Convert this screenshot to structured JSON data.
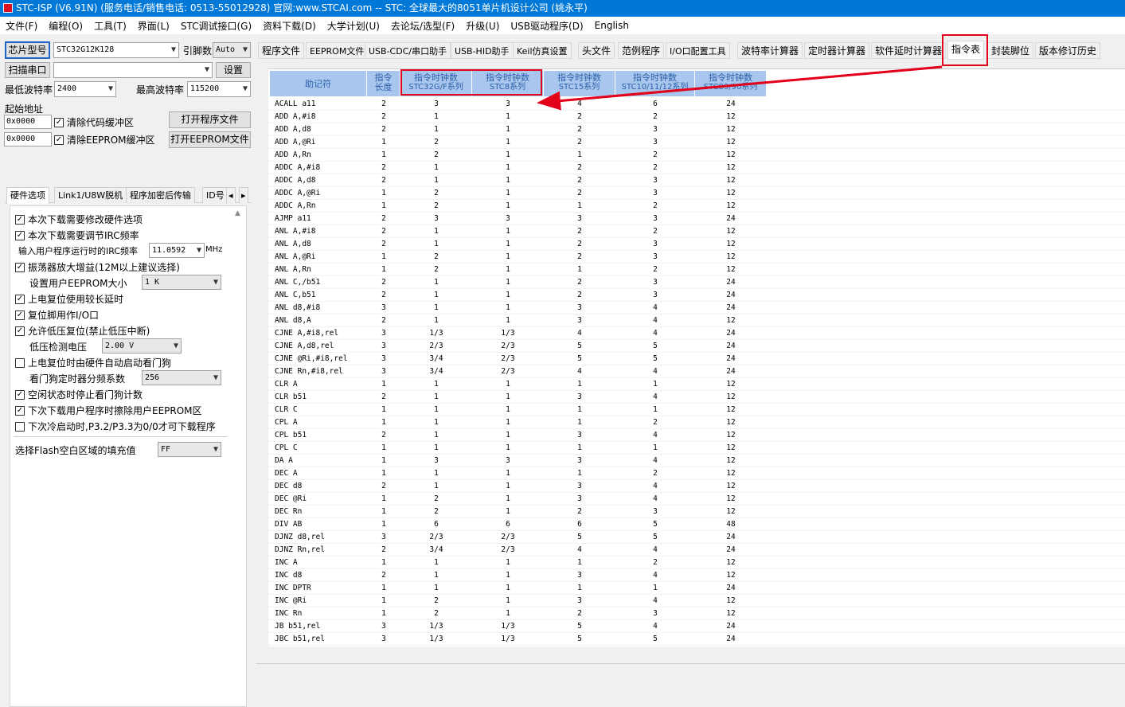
{
  "title": "STC-ISP (V6.91N) (服务电话/销售电话: 0513-55012928) 官网:www.STCAI.com  -- STC: 全球最大的8051单片机设计公司 (姚永平)",
  "menu": [
    "文件(F)",
    "编程(O)",
    "工具(T)",
    "界面(L)",
    "STC调试接口(G)",
    "资料下载(D)",
    "大学计划(U)",
    "去论坛/选型(F)",
    "升级(U)",
    "USB驱动程序(D)",
    "English"
  ],
  "left": {
    "chip_btn": "芯片型号",
    "chip_value": "STC32G12K128",
    "pin_label": "引脚数",
    "pin_value": "Auto",
    "scan_btn": "扫描串口",
    "port_value": "",
    "settings_btn": "设置",
    "min_baud_label": "最低波特率",
    "min_baud": "2400",
    "max_baud_label": "最高波特率",
    "max_baud": "115200",
    "start_addr_label": "起始地址",
    "addr1": "0x0000",
    "addr2": "0x0000",
    "clear_code": "清除代码缓冲区",
    "clear_eeprom": "清除EEPROM缓冲区",
    "open_prog": "打开程序文件",
    "open_eeprom": "打开EEPROM文件",
    "tabs": [
      "硬件选项",
      "Link1/U8W脱机",
      "程序加密后传输",
      "ID号"
    ],
    "opts": {
      "o1": "本次下载需要修改硬件选项",
      "o2": "本次下载需要调节IRC频率",
      "irc_label": "输入用户程序运行时的IRC频率",
      "irc_value": "11.0592",
      "irc_unit": "MHz",
      "o3": "振荡器放大增益(12M以上建议选择)",
      "eeprom_label": "设置用户EEPROM大小",
      "eeprom_value": "1   K",
      "o4": "上电复位使用较长延时",
      "o5": "复位脚用作I/O口",
      "o6": "允许低压复位(禁止低压中断)",
      "lv_label": "低压检测电压",
      "lv_value": "2.00 V",
      "o7": "上电复位时由硬件自动启动看门狗",
      "wdt_label": "看门狗定时器分频系数",
      "wdt_value": "256",
      "o8": "空闲状态时停止看门狗计数",
      "o9": "下次下载用户程序时擦除用户EEPROM区",
      "o10": "下次冷启动时,P3.2/P3.3为0/0才可下载程序",
      "flash_label": "选择Flash空白区域的填充值",
      "flash_value": "FF"
    }
  },
  "right_tabs": [
    "程序文件",
    "EEPROM文件",
    "USB-CDC/串口助手",
    "USB-HID助手",
    "Keil仿真设置",
    "头文件",
    "范例程序",
    "I/O口配置工具",
    "波特率计算器",
    "定时器计算器",
    "软件延时计算器",
    "指令表",
    "封装脚位",
    "版本修订历史"
  ],
  "table": {
    "headers": [
      {
        "l1": "助记符",
        "l2": ""
      },
      {
        "l1": "指令",
        "l2": "长度"
      },
      {
        "l1": "指令时钟数",
        "l2": "STC32G/F系列"
      },
      {
        "l1": "指令时钟数",
        "l2": "STC8系列"
      },
      {
        "l1": "指令时钟数",
        "l2": "STC15系列"
      },
      {
        "l1": "指令时钟数",
        "l2": "STC10/11/12系列"
      },
      {
        "l1": "指令时钟数",
        "l2": "STC89/90系列"
      }
    ],
    "rows": [
      [
        "ACALL a11",
        "2",
        "3",
        "3",
        "4",
        "6",
        "24"
      ],
      [
        "ADD A,#i8",
        "2",
        "1",
        "1",
        "2",
        "2",
        "12"
      ],
      [
        "ADD A,d8",
        "2",
        "1",
        "1",
        "2",
        "3",
        "12"
      ],
      [
        "ADD A,@Ri",
        "1",
        "2",
        "1",
        "2",
        "3",
        "12"
      ],
      [
        "ADD A,Rn",
        "1",
        "2",
        "1",
        "1",
        "2",
        "12"
      ],
      [
        "ADDC A,#i8",
        "2",
        "1",
        "1",
        "2",
        "2",
        "12"
      ],
      [
        "ADDC A,d8",
        "2",
        "1",
        "1",
        "2",
        "3",
        "12"
      ],
      [
        "ADDC A,@Ri",
        "1",
        "2",
        "1",
        "2",
        "3",
        "12"
      ],
      [
        "ADDC A,Rn",
        "1",
        "2",
        "1",
        "1",
        "2",
        "12"
      ],
      [
        "AJMP a11",
        "2",
        "3",
        "3",
        "3",
        "3",
        "24"
      ],
      [
        "ANL A,#i8",
        "2",
        "1",
        "1",
        "2",
        "2",
        "12"
      ],
      [
        "ANL A,d8",
        "2",
        "1",
        "1",
        "2",
        "3",
        "12"
      ],
      [
        "ANL A,@Ri",
        "1",
        "2",
        "1",
        "2",
        "3",
        "12"
      ],
      [
        "ANL A,Rn",
        "1",
        "2",
        "1",
        "1",
        "2",
        "12"
      ],
      [
        "ANL C,/b51",
        "2",
        "1",
        "1",
        "2",
        "3",
        "24"
      ],
      [
        "ANL C,b51",
        "2",
        "1",
        "1",
        "2",
        "3",
        "24"
      ],
      [
        "ANL d8,#i8",
        "3",
        "1",
        "1",
        "3",
        "4",
        "24"
      ],
      [
        "ANL d8,A",
        "2",
        "1",
        "1",
        "3",
        "4",
        "12"
      ],
      [
        "CJNE A,#i8,rel",
        "3",
        "1/3",
        "1/3",
        "4",
        "4",
        "24"
      ],
      [
        "CJNE A,d8,rel",
        "3",
        "2/3",
        "2/3",
        "5",
        "5",
        "24"
      ],
      [
        "CJNE @Ri,#i8,rel",
        "3",
        "3/4",
        "2/3",
        "5",
        "5",
        "24"
      ],
      [
        "CJNE Rn,#i8,rel",
        "3",
        "3/4",
        "2/3",
        "4",
        "4",
        "24"
      ],
      [
        "CLR A",
        "1",
        "1",
        "1",
        "1",
        "1",
        "12"
      ],
      [
        "CLR b51",
        "2",
        "1",
        "1",
        "3",
        "4",
        "12"
      ],
      [
        "CLR C",
        "1",
        "1",
        "1",
        "1",
        "1",
        "12"
      ],
      [
        "CPL A",
        "1",
        "1",
        "1",
        "1",
        "2",
        "12"
      ],
      [
        "CPL b51",
        "2",
        "1",
        "1",
        "3",
        "4",
        "12"
      ],
      [
        "CPL C",
        "1",
        "1",
        "1",
        "1",
        "1",
        "12"
      ],
      [
        "DA A",
        "1",
        "3",
        "3",
        "3",
        "4",
        "12"
      ],
      [
        "DEC A",
        "1",
        "1",
        "1",
        "1",
        "2",
        "12"
      ],
      [
        "DEC d8",
        "2",
        "1",
        "1",
        "3",
        "4",
        "12"
      ],
      [
        "DEC @Ri",
        "1",
        "2",
        "1",
        "3",
        "4",
        "12"
      ],
      [
        "DEC Rn",
        "1",
        "2",
        "1",
        "2",
        "3",
        "12"
      ],
      [
        "DIV AB",
        "1",
        "6",
        "6",
        "6",
        "5",
        "48"
      ],
      [
        "DJNZ d8,rel",
        "3",
        "2/3",
        "2/3",
        "5",
        "5",
        "24"
      ],
      [
        "DJNZ Rn,rel",
        "2",
        "3/4",
        "2/3",
        "4",
        "4",
        "24"
      ],
      [
        "INC A",
        "1",
        "1",
        "1",
        "1",
        "2",
        "12"
      ],
      [
        "INC d8",
        "2",
        "1",
        "1",
        "3",
        "4",
        "12"
      ],
      [
        "INC DPTR",
        "1",
        "1",
        "1",
        "1",
        "1",
        "24"
      ],
      [
        "INC @Ri",
        "1",
        "2",
        "1",
        "3",
        "4",
        "12"
      ],
      [
        "INC Rn",
        "1",
        "2",
        "1",
        "2",
        "3",
        "12"
      ],
      [
        "JB b51,rel",
        "3",
        "1/3",
        "1/3",
        "5",
        "4",
        "24"
      ],
      [
        "JBC b51,rel",
        "3",
        "1/3",
        "1/3",
        "5",
        "5",
        "24"
      ]
    ]
  },
  "colors": {
    "highlight": "#e3001a",
    "header_bg": "#a9c7ee",
    "header_text": "#2b5fa8",
    "titlebar": "#0078d7"
  }
}
